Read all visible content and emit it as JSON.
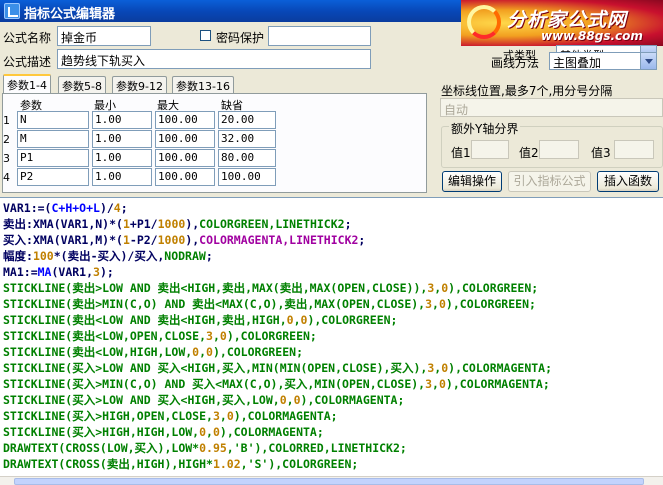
{
  "window": {
    "title": "指标公式编辑器"
  },
  "logo": {
    "name": "分析家公式网",
    "url": "www.88gs.com"
  },
  "form": {
    "name_label": "公式名称",
    "name_value": "掉金币",
    "password_label": "密码保护",
    "desc_label": "公式描述",
    "desc_value": "趋势线下轨买入",
    "type_label": "式类型",
    "type_value": "其他类型",
    "draw_label": "画线方法",
    "draw_value": "主图叠加"
  },
  "tabs": [
    "参数1-4",
    "参数5-8",
    "参数9-12",
    "参数13-16"
  ],
  "params": {
    "headers": [
      "参数",
      "最小",
      "最大",
      "缺省"
    ],
    "rows": [
      {
        "num": "1",
        "name": "N",
        "min": "1.00",
        "max": "100.00",
        "default": "20.00"
      },
      {
        "num": "2",
        "name": "M",
        "min": "1.00",
        "max": "100.00",
        "default": "32.00"
      },
      {
        "num": "3",
        "name": "P1",
        "min": "1.00",
        "max": "100.00",
        "default": "80.00"
      },
      {
        "num": "4",
        "name": "P2",
        "min": "1.00",
        "max": "100.00",
        "default": "100.00"
      }
    ]
  },
  "coord": {
    "label": "坐标线位置,最多7个,用分号分隔",
    "value": "自动"
  },
  "yaxis": {
    "title": "额外Y轴分界",
    "labels": [
      "值1",
      "值2",
      "值3"
    ]
  },
  "buttons": {
    "edit": "编辑操作",
    "import": "引入指标公式",
    "insert": "插入函数"
  },
  "code": [
    [
      [
        "VAR1:=(",
        "c-dark"
      ],
      [
        "C+H+O+L",
        "c-blue"
      ],
      [
        ")/",
        "c-dark"
      ],
      [
        "4",
        "c-num"
      ],
      [
        ";",
        "c-dark"
      ]
    ],
    [
      [
        "卖出:",
        "c-dark"
      ],
      [
        "XMA",
        "c-dark"
      ],
      [
        "(VAR1,N)*(",
        "c-dark"
      ],
      [
        "1",
        "c-num"
      ],
      [
        "+P1/",
        "c-dark"
      ],
      [
        "1000",
        "c-num"
      ],
      [
        "),",
        "c-dark"
      ],
      [
        "COLORGREEN,LINETHICK2",
        "c-green"
      ],
      [
        ";",
        "c-dark"
      ]
    ],
    [
      [
        "买入:",
        "c-dark"
      ],
      [
        "XMA",
        "c-dark"
      ],
      [
        "(VAR1,M)*(",
        "c-dark"
      ],
      [
        "1",
        "c-num"
      ],
      [
        "-P2/",
        "c-dark"
      ],
      [
        "1000",
        "c-num"
      ],
      [
        "),",
        "c-dark"
      ],
      [
        "COLORMAGENTA,LINETHICK2",
        "c-mag"
      ],
      [
        ";",
        "c-dark"
      ]
    ],
    [
      [
        "幅度:",
        "c-dark"
      ],
      [
        "100",
        "c-num"
      ],
      [
        "*(卖出-买入)/买入,",
        "c-dark"
      ],
      [
        "NODRAW",
        "c-green"
      ],
      [
        ";",
        "c-dark"
      ]
    ],
    [
      [
        "MA1:=",
        "c-dark"
      ],
      [
        "MA",
        "c-blue"
      ],
      [
        "(VAR1,",
        "c-dark"
      ],
      [
        "3",
        "c-num"
      ],
      [
        ");",
        "c-dark"
      ]
    ],
    [
      [
        "STICKLINE(卖出>LOW AND 卖出<HIGH,卖出,MAX(卖出,MAX(OPEN,CLOSE)),",
        "c-green"
      ],
      [
        "3",
        "c-num"
      ],
      [
        ",",
        "c-green"
      ],
      [
        "0",
        "c-num"
      ],
      [
        "),COLORGREEN;",
        "c-green"
      ]
    ],
    [
      [
        "STICKLINE(卖出>MIN(C,O) AND 卖出<MAX(C,O),卖出,MAX(OPEN,CLOSE),",
        "c-green"
      ],
      [
        "3",
        "c-num"
      ],
      [
        ",",
        "c-green"
      ],
      [
        "0",
        "c-num"
      ],
      [
        "),COLORGREEN;",
        "c-green"
      ]
    ],
    [
      [
        "STICKLINE(卖出<LOW AND 卖出<HIGH,卖出,HIGH,",
        "c-green"
      ],
      [
        "0",
        "c-num"
      ],
      [
        ",",
        "c-green"
      ],
      [
        "0",
        "c-num"
      ],
      [
        "),COLORGREEN;",
        "c-green"
      ]
    ],
    [
      [
        "STICKLINE(卖出<LOW,OPEN,CLOSE,",
        "c-green"
      ],
      [
        "3",
        "c-num"
      ],
      [
        ",",
        "c-green"
      ],
      [
        "0",
        "c-num"
      ],
      [
        "),COLORGREEN;",
        "c-green"
      ]
    ],
    [
      [
        "STICKLINE(卖出<LOW,HIGH,LOW,",
        "c-green"
      ],
      [
        "0",
        "c-num"
      ],
      [
        ",",
        "c-green"
      ],
      [
        "0",
        "c-num"
      ],
      [
        "),COLORGREEN;",
        "c-green"
      ]
    ],
    [
      [
        "STICKLINE(买入>LOW AND 买入<HIGH,买入,MIN(MIN(OPEN,CLOSE),买入),",
        "c-green"
      ],
      [
        "3",
        "c-num"
      ],
      [
        ",",
        "c-green"
      ],
      [
        "0",
        "c-num"
      ],
      [
        "),COLORMAGENTA;",
        "c-green"
      ]
    ],
    [
      [
        "STICKLINE(买入>MIN(C,O) AND 买入<MAX(C,O),买入,MIN(OPEN,CLOSE),",
        "c-green"
      ],
      [
        "3",
        "c-num"
      ],
      [
        ",",
        "c-green"
      ],
      [
        "0",
        "c-num"
      ],
      [
        "),COLORMAGENTA;",
        "c-green"
      ]
    ],
    [
      [
        "STICKLINE(买入>LOW AND 买入<HIGH,买入,LOW,",
        "c-green"
      ],
      [
        "0",
        "c-num"
      ],
      [
        ",",
        "c-green"
      ],
      [
        "0",
        "c-num"
      ],
      [
        "),COLORMAGENTA;",
        "c-green"
      ]
    ],
    [
      [
        "STICKLINE(买入>HIGH,OPEN,CLOSE,",
        "c-green"
      ],
      [
        "3",
        "c-num"
      ],
      [
        ",",
        "c-green"
      ],
      [
        "0",
        "c-num"
      ],
      [
        "),COLORMAGENTA;",
        "c-green"
      ]
    ],
    [
      [
        "STICKLINE(买入>HIGH,HIGH,LOW,",
        "c-green"
      ],
      [
        "0",
        "c-num"
      ],
      [
        ",",
        "c-green"
      ],
      [
        "0",
        "c-num"
      ],
      [
        "),COLORMAGENTA;",
        "c-green"
      ]
    ],
    [
      [
        "DRAWTEXT(CROSS(LOW,买入),LOW*",
        "c-green"
      ],
      [
        "0.95",
        "c-num"
      ],
      [
        ",'B'),COLORRED,LINETHICK2;",
        "c-green"
      ]
    ],
    [
      [
        "DRAWTEXT(CROSS(卖出,HIGH),HIGH*",
        "c-green"
      ],
      [
        "1.02",
        "c-num"
      ],
      [
        ",'S'),COLORGREEN;",
        "c-green"
      ]
    ]
  ]
}
